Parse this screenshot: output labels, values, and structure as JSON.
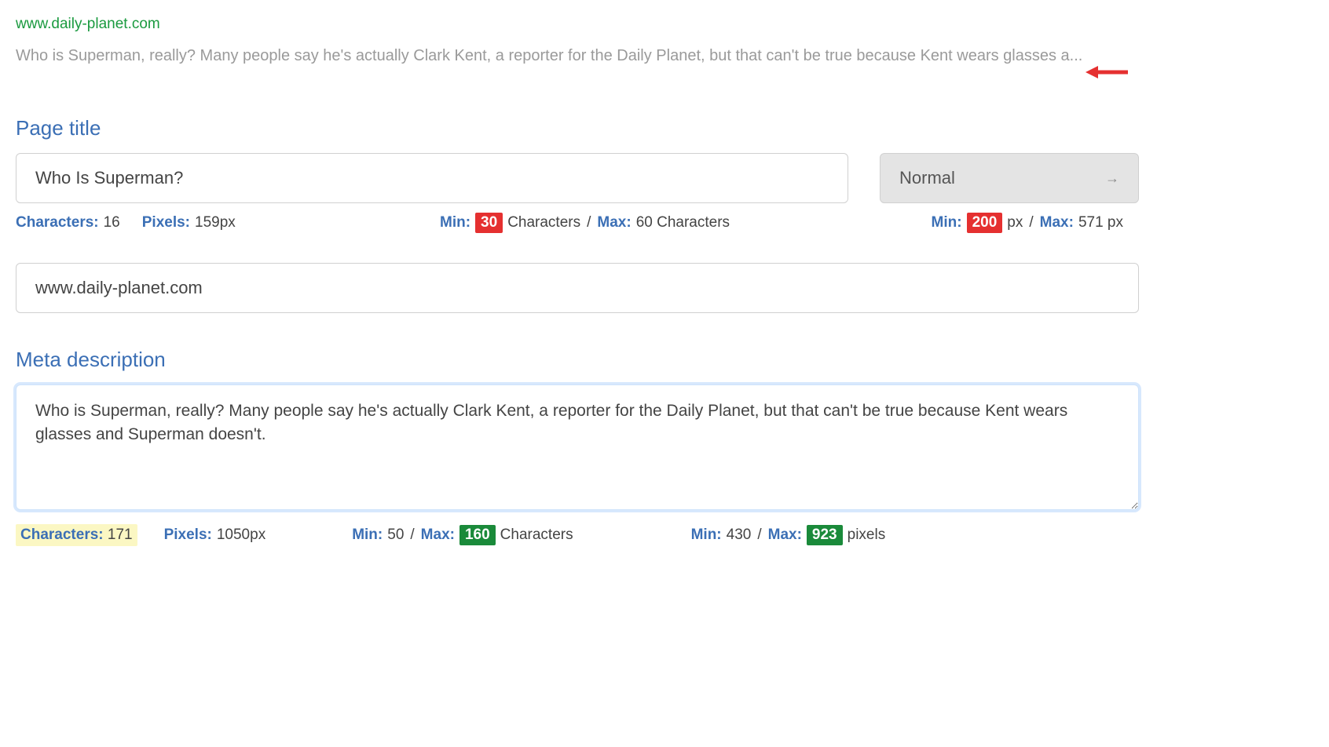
{
  "preview": {
    "url": "www.daily-planet.com",
    "description": "Who is Superman, really? Many people say he's actually Clark Kent, a reporter for the Daily Planet, but that can't be true because Kent wears glasses a..."
  },
  "pageTitle": {
    "heading": "Page title",
    "value": "Who Is Superman?",
    "dropdown": "Normal",
    "stats": {
      "charsLabel": "Characters:",
      "charsValue": "16",
      "pixelsLabel": "Pixels:",
      "pixelsValue": "159px",
      "minLabel": "Min:",
      "minCharsBadge": "30",
      "minCharsSuffix": "Characters",
      "maxLabel": "Max:",
      "maxCharsValue": "60 Characters",
      "minPxLabel": "Min:",
      "minPxBadge": "200",
      "minPxSuffix": "px",
      "maxPxLabel": "Max:",
      "maxPxValue": "571 px"
    }
  },
  "urlField": {
    "value": "www.daily-planet.com"
  },
  "metaDescription": {
    "heading": "Meta description",
    "value": "Who is Superman, really? Many people say he's actually Clark Kent, a reporter for the Daily Planet, but that can't be true because Kent wears glasses and Superman doesn't.",
    "stats": {
      "charsLabel": "Characters:",
      "charsValue": "171",
      "pixelsLabel": "Pixels:",
      "pixelsValue": "1050px",
      "minLabel": "Min:",
      "minValue": "50",
      "maxLabel": "Max:",
      "maxBadge": "160",
      "maxSuffix": "Characters",
      "minPxLabel": "Min:",
      "minPxValue": "430",
      "maxPxLabel": "Max:",
      "maxPxBadge": "923",
      "maxPxSuffix": "pixels"
    }
  }
}
